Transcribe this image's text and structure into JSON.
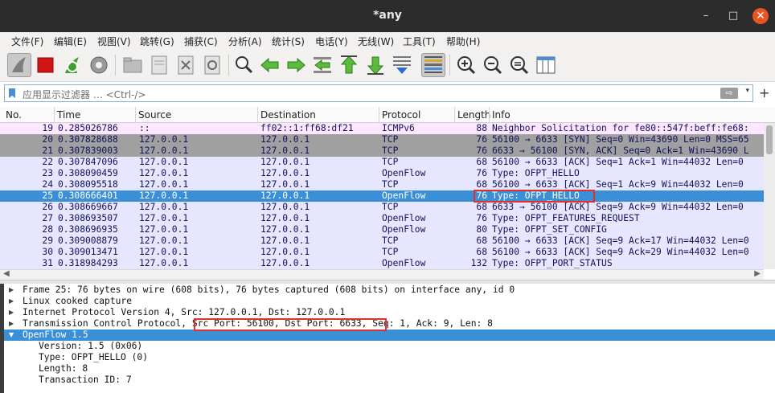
{
  "window": {
    "title": "*any",
    "min": "–",
    "max": "□",
    "close": "✕"
  },
  "menu": [
    "文件(F)",
    "编辑(E)",
    "视图(V)",
    "跳转(G)",
    "捕获(C)",
    "分析(A)",
    "统计(S)",
    "电话(Y)",
    "无线(W)",
    "工具(T)",
    "帮助(H)"
  ],
  "toolbar": {
    "buttons": [
      "shark-fin-start-icon",
      "stop-capture-icon",
      "restart-capture-icon",
      "capture-options-icon",
      "open-file-icon",
      "save-file-icon",
      "close-file-icon",
      "reload-file-icon",
      "find-packet-icon",
      "go-back-icon",
      "go-forward-icon",
      "go-to-packet-icon",
      "go-first-icon",
      "go-last-icon",
      "autoscroll-icon",
      "colorize-icon",
      "zoom-in-icon",
      "zoom-out-icon",
      "normal-size-icon",
      "resize-columns-icon"
    ]
  },
  "filter": {
    "placeholder": "应用显示过滤器 … <Ctrl-/>",
    "apply": "⇨",
    "dropdown": "▾",
    "plus": "+"
  },
  "packet_list": {
    "columns": [
      "No.",
      "Time",
      "Source",
      "Destination",
      "Protocol",
      "Length",
      "Info"
    ],
    "rows": [
      {
        "no": "19",
        "time": "0.285026786",
        "src": "::",
        "dst": "ff02::1:ff68:df21",
        "proto": "ICMPv6",
        "len": "88",
        "info": "Neighbor Solicitation for fe80::547f:beff:fe68:",
        "style": "icmp"
      },
      {
        "no": "20",
        "time": "0.307828688",
        "src": "127.0.0.1",
        "dst": "127.0.0.1",
        "proto": "TCP",
        "len": "76",
        "info": "56100 → 6633 [SYN] Seq=0 Win=43690 Len=0 MSS=65",
        "style": "gray"
      },
      {
        "no": "21",
        "time": "0.307839003",
        "src": "127.0.0.1",
        "dst": "127.0.0.1",
        "proto": "TCP",
        "len": "76",
        "info": "6633 → 56100 [SYN, ACK] Seq=0 Ack=1 Win=43690 L",
        "style": "gray"
      },
      {
        "no": "22",
        "time": "0.307847096",
        "src": "127.0.0.1",
        "dst": "127.0.0.1",
        "proto": "TCP",
        "len": "68",
        "info": "56100 → 6633 [ACK] Seq=1 Ack=1 Win=44032 Len=0",
        "style": "tcp"
      },
      {
        "no": "23",
        "time": "0.308090459",
        "src": "127.0.0.1",
        "dst": "127.0.0.1",
        "proto": "OpenFlow",
        "len": "76",
        "info": "Type: OFPT_HELLO",
        "style": "tcp"
      },
      {
        "no": "24",
        "time": "0.308095518",
        "src": "127.0.0.1",
        "dst": "127.0.0.1",
        "proto": "TCP",
        "len": "68",
        "info": "56100 → 6633 [ACK] Seq=1 Ack=9 Win=44032 Len=0",
        "style": "tcp"
      },
      {
        "no": "25",
        "time": "0.308666401",
        "src": "127.0.0.1",
        "dst": "127.0.0.1",
        "proto": "OpenFlow",
        "len": "76",
        "info": "Type: OFPT_HELLO",
        "style": "sel"
      },
      {
        "no": "26",
        "time": "0.308669667",
        "src": "127.0.0.1",
        "dst": "127.0.0.1",
        "proto": "TCP",
        "len": "68",
        "info": "6633 → 56100 [ACK] Seq=9 Ack=9 Win=44032 Len=0",
        "style": "tcp"
      },
      {
        "no": "27",
        "time": "0.308693507",
        "src": "127.0.0.1",
        "dst": "127.0.0.1",
        "proto": "OpenFlow",
        "len": "76",
        "info": "Type: OFPT_FEATURES_REQUEST",
        "style": "tcp"
      },
      {
        "no": "28",
        "time": "0.308696935",
        "src": "127.0.0.1",
        "dst": "127.0.0.1",
        "proto": "OpenFlow",
        "len": "80",
        "info": "Type: OFPT_SET_CONFIG",
        "style": "tcp"
      },
      {
        "no": "29",
        "time": "0.309008879",
        "src": "127.0.0.1",
        "dst": "127.0.0.1",
        "proto": "TCP",
        "len": "68",
        "info": "56100 → 6633 [ACK] Seq=9 Ack=17 Win=44032 Len=0",
        "style": "tcp"
      },
      {
        "no": "30",
        "time": "0.309013471",
        "src": "127.0.0.1",
        "dst": "127.0.0.1",
        "proto": "TCP",
        "len": "68",
        "info": "56100 → 6633 [ACK] Seq=9 Ack=29 Win=44032 Len=0",
        "style": "tcp"
      },
      {
        "no": "31",
        "time": "0.318984293",
        "src": "127.0.0.1",
        "dst": "127.0.0.1",
        "proto": "OpenFlow",
        "len": "132",
        "info": "Type: OFPT_PORT_STATUS",
        "style": "tcp"
      }
    ]
  },
  "details": [
    {
      "text": "Frame 25: 76 bytes on wire (608 bits), 76 bytes captured (608 bits) on interface any, id 0",
      "arrow": "▶",
      "indent": 0
    },
    {
      "text": "Linux cooked capture",
      "arrow": "▶",
      "indent": 0
    },
    {
      "text": "Internet Protocol Version 4, Src: 127.0.0.1, Dst: 127.0.0.1",
      "arrow": "▶",
      "indent": 0
    },
    {
      "text": "Transmission Control Protocol, Src Port: 56100, Dst Port: 6633, Seq: 1, Ack: 9, Len: 8",
      "arrow": "▶",
      "indent": 0
    },
    {
      "text": "OpenFlow 1.5",
      "arrow": "▼",
      "indent": 0,
      "selected": true
    },
    {
      "text": "Version: 1.5 (0x06)",
      "arrow": "",
      "indent": 1
    },
    {
      "text": "Type: OFPT_HELLO (0)",
      "arrow": "",
      "indent": 1
    },
    {
      "text": "Length: 8",
      "arrow": "",
      "indent": 1
    },
    {
      "text": "Transaction ID: 7",
      "arrow": "",
      "indent": 1
    }
  ],
  "colors": {
    "selected": "#3a8fd6",
    "highlight_box": "#e2302b",
    "tcp_row": "#e7e6ff",
    "icmp_row": "#fde6ff",
    "syn_row": "#a0a0a0"
  }
}
